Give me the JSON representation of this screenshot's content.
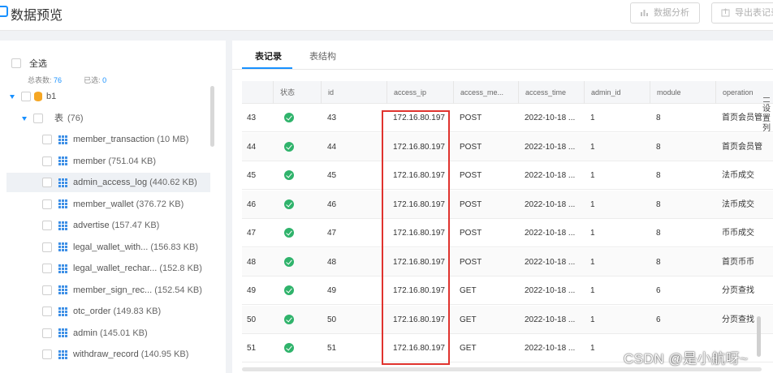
{
  "header": {
    "title": "数据预览",
    "analyze_label": "数据分析",
    "export_label": "导出表记录"
  },
  "left_panel": {
    "select_all": "全选",
    "total_label": "总表数:",
    "total_value": "76",
    "selected_label": "已选:",
    "selected_value": "0",
    "database": "b1",
    "tables_group": "表",
    "tables_count": "(76)",
    "tables": [
      {
        "name": "member_transaction",
        "size": "(10 MB)"
      },
      {
        "name": "member",
        "size": "(751.04 KB)"
      },
      {
        "name": "admin_access_log",
        "size": "(440.62 KB)"
      },
      {
        "name": "member_wallet",
        "size": "(376.72 KB)"
      },
      {
        "name": "advertise",
        "size": "(157.47 KB)"
      },
      {
        "name": "legal_wallet_with...",
        "size": "(156.83 KB)"
      },
      {
        "name": "legal_wallet_rechar...",
        "size": "(152.8 KB)"
      },
      {
        "name": "member_sign_rec...",
        "size": "(152.54 KB)"
      },
      {
        "name": "otc_order",
        "size": "(149.83 KB)"
      },
      {
        "name": "admin",
        "size": "(145.01 KB)"
      },
      {
        "name": "withdraw_record",
        "size": "(140.95 KB)"
      }
    ]
  },
  "tabs": [
    "表记录",
    "表结构"
  ],
  "grid": {
    "columns": [
      "",
      "状态",
      "id",
      "access_ip",
      "access_me...",
      "access_time",
      "admin_id",
      "module",
      "operation"
    ],
    "rows": [
      {
        "n": "43",
        "id": "43",
        "ip": "172.16.80.197",
        "method": "POST",
        "time": "2022-10-18 ...",
        "admin": "1",
        "module": "8",
        "op": "首页会员管"
      },
      {
        "n": "44",
        "id": "44",
        "ip": "172.16.80.197",
        "method": "POST",
        "time": "2022-10-18 ...",
        "admin": "1",
        "module": "8",
        "op": "首页会员管"
      },
      {
        "n": "45",
        "id": "45",
        "ip": "172.16.80.197",
        "method": "POST",
        "time": "2022-10-18 ...",
        "admin": "1",
        "module": "8",
        "op": "法币成交"
      },
      {
        "n": "46",
        "id": "46",
        "ip": "172.16.80.197",
        "method": "POST",
        "time": "2022-10-18 ...",
        "admin": "1",
        "module": "8",
        "op": "法币成交"
      },
      {
        "n": "47",
        "id": "47",
        "ip": "172.16.80.197",
        "method": "POST",
        "time": "2022-10-18 ...",
        "admin": "1",
        "module": "8",
        "op": "币币成交"
      },
      {
        "n": "48",
        "id": "48",
        "ip": "172.16.80.197",
        "method": "POST",
        "time": "2022-10-18 ...",
        "admin": "1",
        "module": "8",
        "op": "首页币币"
      },
      {
        "n": "49",
        "id": "49",
        "ip": "172.16.80.197",
        "method": "GET",
        "time": "2022-10-18 ...",
        "admin": "1",
        "module": "6",
        "op": "分页查找"
      },
      {
        "n": "50",
        "id": "50",
        "ip": "172.16.80.197",
        "method": "GET",
        "time": "2022-10-18 ...",
        "admin": "1",
        "module": "6",
        "op": "分页查找"
      },
      {
        "n": "51",
        "id": "51",
        "ip": "172.16.80.197",
        "method": "GET",
        "time": "2022-10-18 ...",
        "admin": "1",
        "module": "",
        "op": ""
      }
    ]
  },
  "side": {
    "settings_label": "设置列"
  },
  "watermark": "CSDN @是小航呀~"
}
